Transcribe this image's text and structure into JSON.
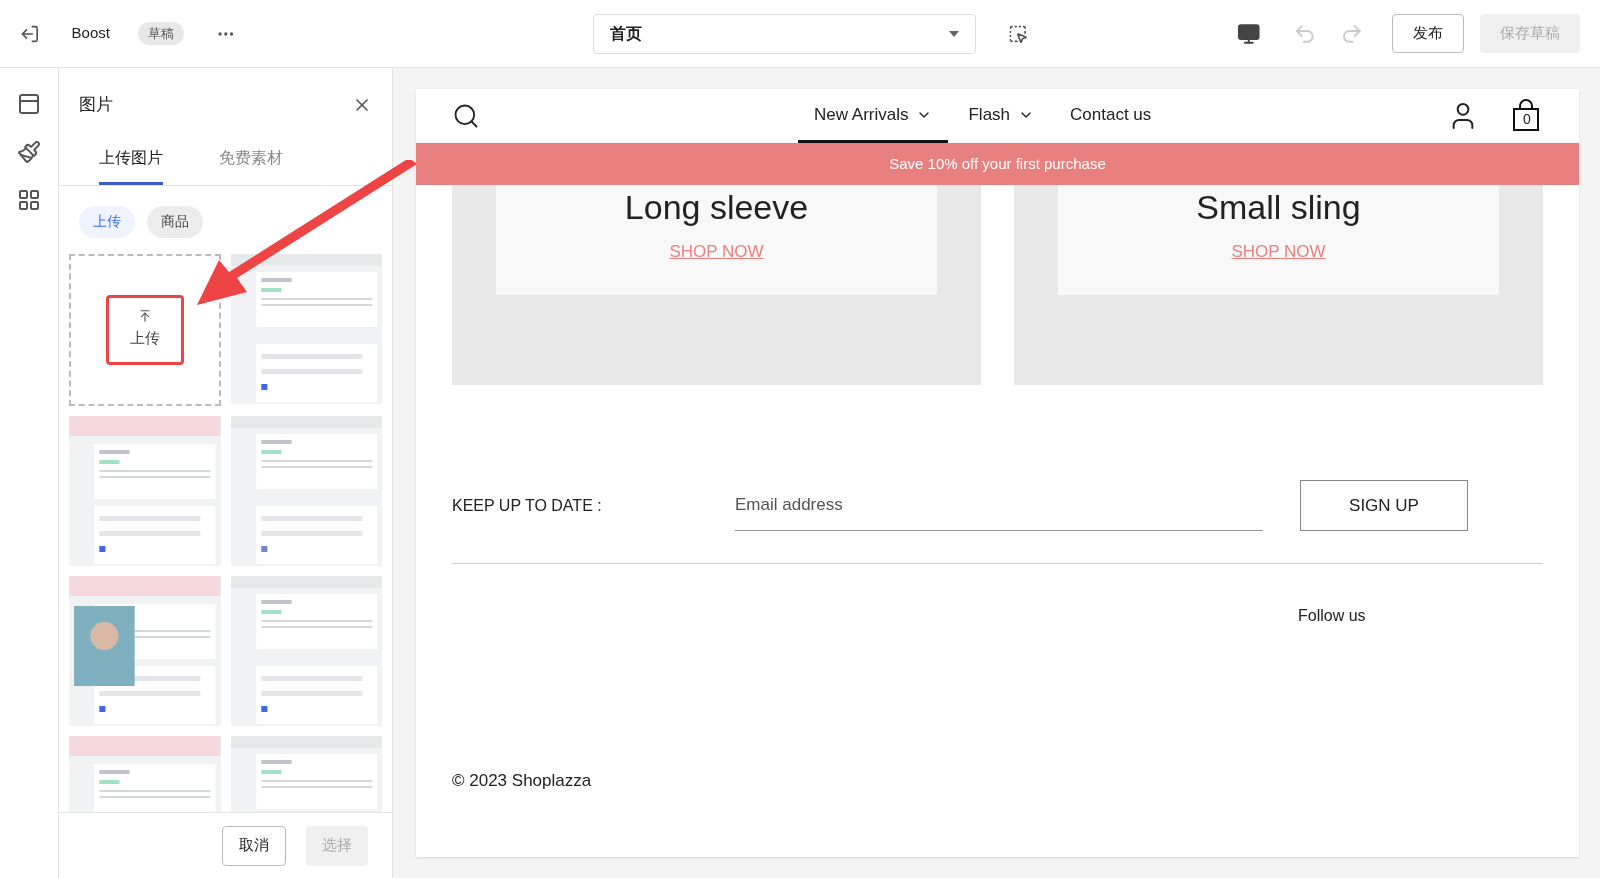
{
  "topbar": {
    "app_name": "Boost",
    "status_badge": "草稿",
    "page_select": {
      "value": "首页"
    },
    "buttons": [
      {
        "label": "发布",
        "disabled": false
      },
      {
        "label": "保存草稿",
        "disabled": true
      }
    ]
  },
  "panel": {
    "title": "图片",
    "tabs": [
      {
        "label": "上传图片",
        "selected": true
      },
      {
        "label": "免费素材",
        "selected": false
      }
    ],
    "filters": [
      {
        "label": "上传",
        "selected": true
      },
      {
        "label": "商品",
        "selected": false
      }
    ],
    "upload_tile": {
      "label": "上传"
    },
    "footer_buttons": [
      {
        "label": "取消",
        "disabled": false
      },
      {
        "label": "选择",
        "disabled": true
      }
    ]
  },
  "store": {
    "nav": [
      {
        "label": "New Arrivals",
        "dropdown": true,
        "selected": true
      },
      {
        "label": "Flash",
        "dropdown": true,
        "selected": false
      },
      {
        "label": "Contact us",
        "dropdown": false,
        "selected": false
      }
    ],
    "cart_count": "0",
    "banner": "Save 10% off your first purchase",
    "collections": [
      {
        "title": "Long sleeve",
        "link": "SHOP NOW"
      },
      {
        "title": "Small sling",
        "link": "SHOP NOW"
      }
    ],
    "newsletter": {
      "label": "KEEP UP TO DATE :",
      "placeholder": "Email address",
      "button": "SIGN UP"
    },
    "follow": "Follow us",
    "copyright": "© 2023 Shoplazza"
  }
}
